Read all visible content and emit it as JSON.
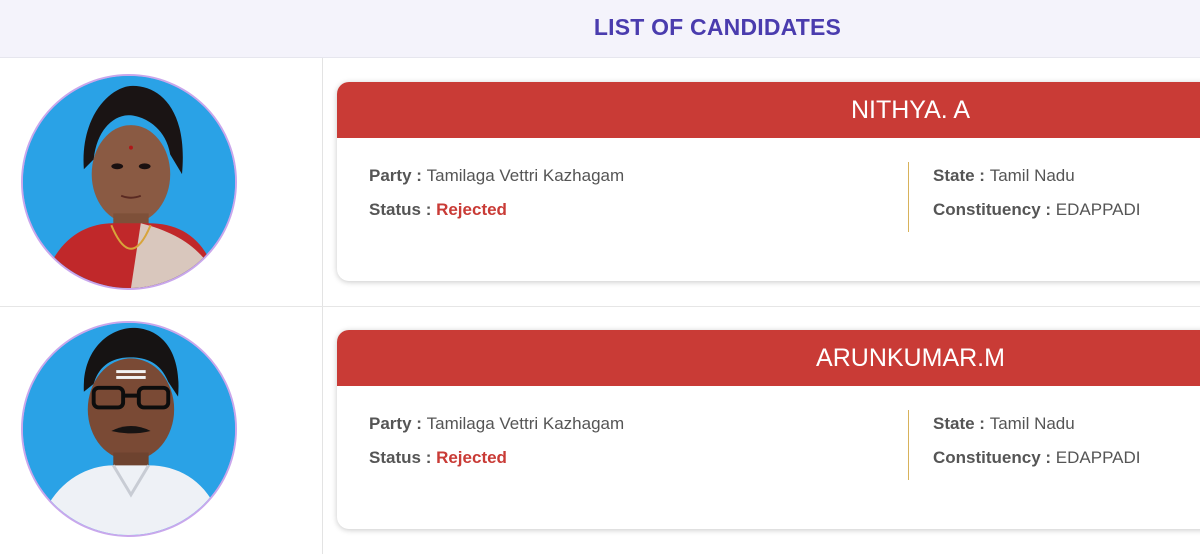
{
  "header": {
    "title": "LIST OF CANDIDATES"
  },
  "labels": {
    "party": "Party",
    "status": "Status",
    "state": "State",
    "constituency": "Constituency",
    "separator": " : "
  },
  "candidates": [
    {
      "name": "NITHYA. A",
      "party": "Tamilaga Vettri Kazhagam",
      "status": "Rejected",
      "state": "Tamil Nadu",
      "constituency": "EDAPPADI"
    },
    {
      "name": "ARUNKUMAR.M",
      "party": "Tamilaga Vettri Kazhagam",
      "status": "Rejected",
      "state": "Tamil Nadu",
      "constituency": "EDAPPADI"
    }
  ],
  "colors": {
    "title": "#4a3cae",
    "card_header": "#c93b36",
    "status_rejected": "#c93b36",
    "photo_border": "#c9a7ec",
    "photo_background": "#2aa2e6"
  }
}
